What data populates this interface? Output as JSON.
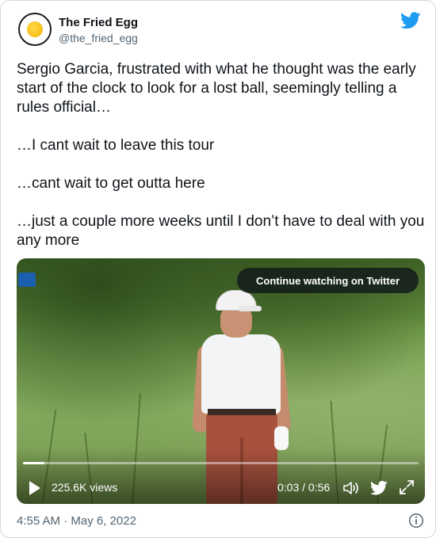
{
  "author": {
    "name": "The Fried Egg",
    "handle": "@the_fried_egg"
  },
  "tweet": {
    "paragraphs": [
      "Sergio Garcia, frustrated with what he thought was the early start of the clock to look for a lost ball, seemingly telling a rules official…",
      "…I cant wait to leave this tour",
      "…cant wait to get outta here",
      "…just a couple more weeks until I don’t have to deal with you any more"
    ],
    "timestamp": "4:55 AM · May 6, 2022"
  },
  "video": {
    "continue_label": "Continue watching on Twitter",
    "views": "225.6K views",
    "time": "0:03 / 0:56",
    "progress_fraction": 0.054
  },
  "icons": {
    "logo": "twitter-bird-icon",
    "play": "play-icon",
    "volume": "volume-icon",
    "fullscreen": "fullscreen-icon",
    "info": "info-icon"
  },
  "colors": {
    "brand_blue": "#1d9bf0",
    "text_primary": "#0f1419",
    "text_secondary": "#536471"
  }
}
